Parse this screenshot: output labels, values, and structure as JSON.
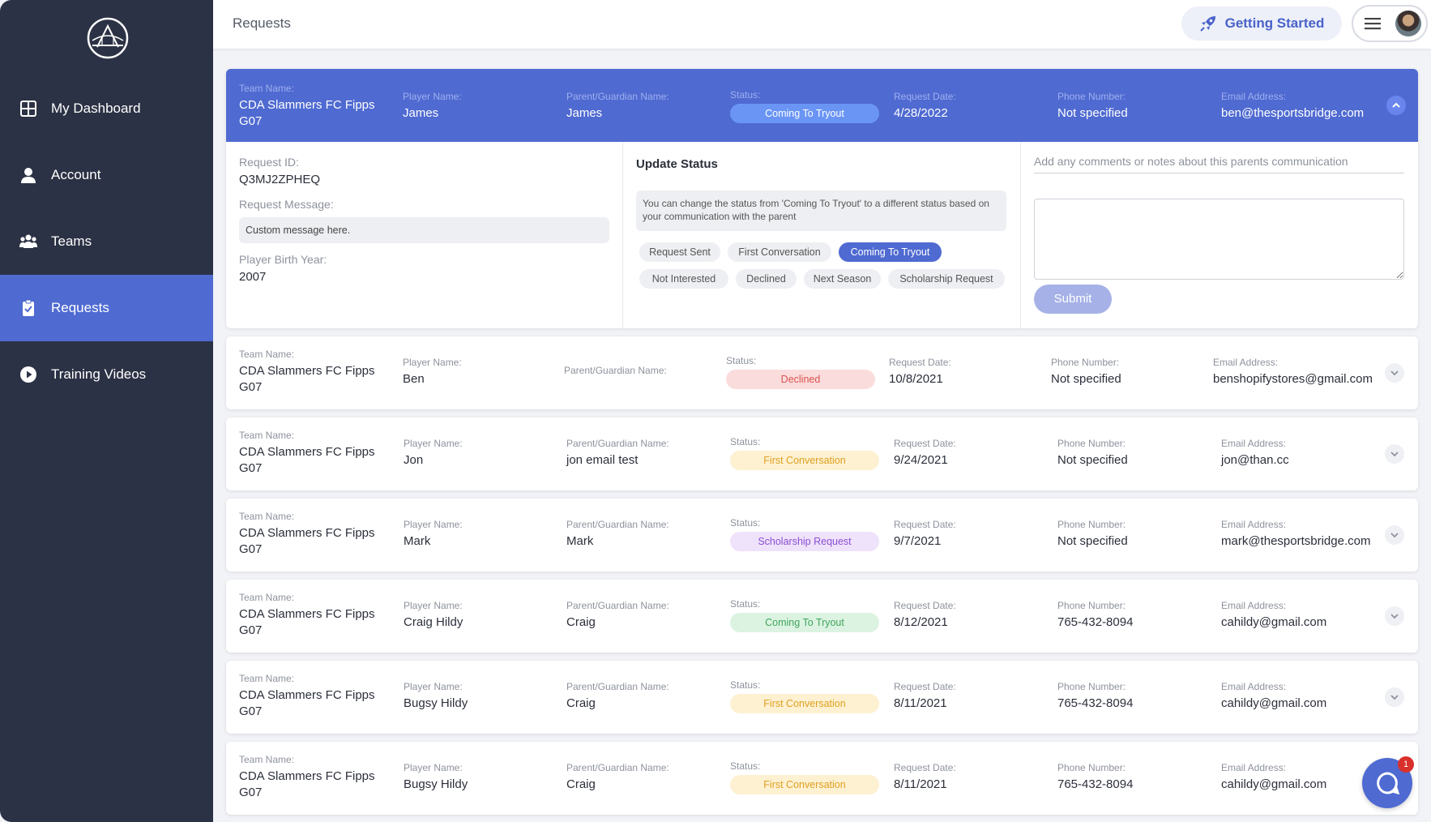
{
  "sidebar": {
    "items": [
      {
        "label": "My Dashboard",
        "icon": "dashboard-icon"
      },
      {
        "label": "Account",
        "icon": "user-icon"
      },
      {
        "label": "Teams",
        "icon": "group-icon"
      },
      {
        "label": "Requests",
        "icon": "clipboard-icon",
        "active": true
      },
      {
        "label": "Training Videos",
        "icon": "play-circle-icon"
      }
    ]
  },
  "header": {
    "title": "Requests",
    "getting_started": "Getting Started"
  },
  "labels": {
    "team": "Team Name:",
    "player": "Player Name:",
    "parent": "Parent/Guardian Name:",
    "status": "Status:",
    "date": "Request Date:",
    "phone": "Phone Number:",
    "email": "Email Address:"
  },
  "expanded": {
    "team": "CDA Slammers FC Fipps G07",
    "player": "James",
    "parent": "James",
    "status": "Coming To Tryout",
    "date": "4/28/2022",
    "phone": "Not specified",
    "email": "ben@thesportsbridge.com",
    "request_id_label": "Request ID:",
    "request_id": "Q3MJ2ZPHEQ",
    "request_message_label": "Request Message:",
    "request_message": "Custom message here.",
    "birth_year_label": "Player Birth Year:",
    "birth_year": "2007",
    "update_status_title": "Update Status",
    "update_status_hint": "You can change the status from 'Coming To Tryout' to a different status based on your communication with the parent",
    "status_options": [
      "Request Sent",
      "First Conversation",
      "Coming To Tryout",
      "Not Interested",
      "Declined",
      "Next Season",
      "Scholarship Request"
    ],
    "selected_status": "Coming To Tryout",
    "notes_placeholder": "Add any comments or notes about this parents communication",
    "submit_label": "Submit"
  },
  "requests": [
    {
      "team": "CDA Slammers FC Fipps G07",
      "player": "Ben",
      "parent": "",
      "status": "Declined",
      "status_color": "#d9534f",
      "status_bg": "#fbdcdc",
      "date": "10/8/2021",
      "phone": "Not specified",
      "email": "benshopifystores@gmail.com"
    },
    {
      "team": "CDA Slammers FC Fipps G07",
      "player": "Jon",
      "parent": "jon email test",
      "status": "First Conversation",
      "status_color": "#e0a020",
      "status_bg": "#fdf1d2",
      "date": "9/24/2021",
      "phone": "Not specified",
      "email": "jon@than.cc"
    },
    {
      "team": "CDA Slammers FC Fipps G07",
      "player": "Mark",
      "parent": "Mark",
      "status": "Scholarship Request",
      "status_color": "#8a4fd1",
      "status_bg": "#efe2fb",
      "date": "9/7/2021",
      "phone": "Not specified",
      "email": "mark@thesportsbridge.com"
    },
    {
      "team": "CDA Slammers FC Fipps G07",
      "player": "Craig Hildy",
      "parent": "Craig",
      "status": "Coming To Tryout",
      "status_color": "#3fa65a",
      "status_bg": "#dcf3e2",
      "date": "8/12/2021",
      "phone": "765-432-8094",
      "email": "cahildy@gmail.com"
    },
    {
      "team": "CDA Slammers FC Fipps G07",
      "player": "Bugsy Hildy",
      "parent": "Craig",
      "status": "First Conversation",
      "status_color": "#e0a020",
      "status_bg": "#fdf1d2",
      "date": "8/11/2021",
      "phone": "765-432-8094",
      "email": "cahildy@gmail.com"
    },
    {
      "team": "CDA Slammers FC Fipps G07",
      "player": "Bugsy Hildy",
      "parent": "Craig",
      "status": "First Conversation",
      "status_color": "#e0a020",
      "status_bg": "#fdf1d2",
      "date": "8/11/2021",
      "phone": "765-432-8094",
      "email": "cahildy@gmail.com"
    }
  ],
  "chat": {
    "badge_count": "1"
  },
  "colors": {
    "accent": "#4f6ad1",
    "sidebar": "#2c3245"
  }
}
